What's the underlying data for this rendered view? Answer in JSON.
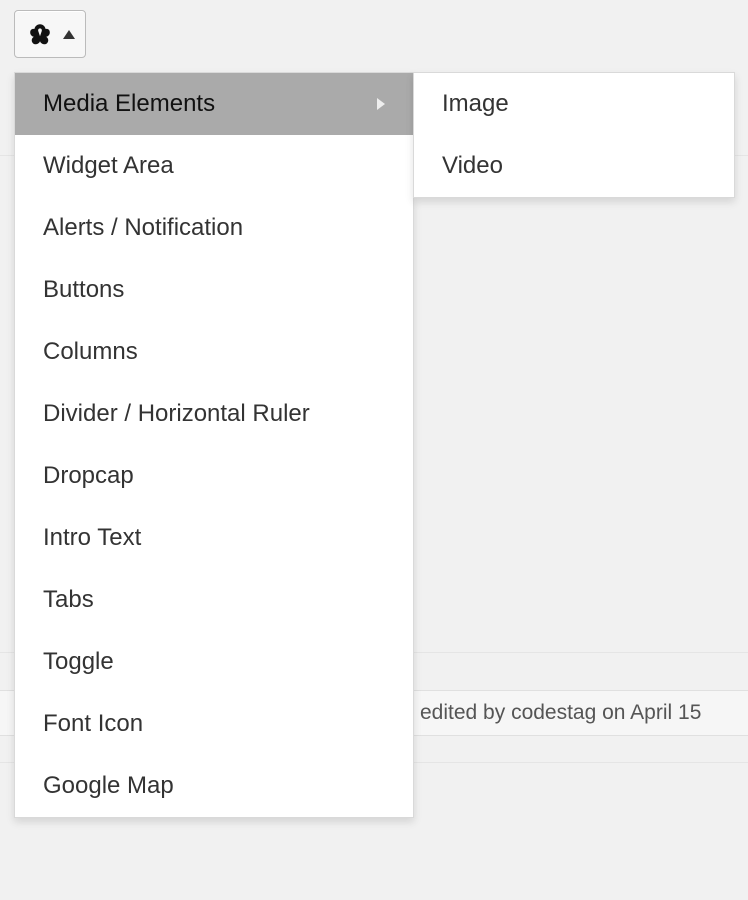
{
  "toolbar": {
    "button_icon": "antler-icon",
    "arrow_direction": "up"
  },
  "menu": {
    "items": [
      {
        "label": "Media Elements",
        "has_submenu": true,
        "active": true
      },
      {
        "label": "Widget Area",
        "has_submenu": false,
        "active": false
      },
      {
        "label": "Alerts / Notification",
        "has_submenu": false,
        "active": false
      },
      {
        "label": "Buttons",
        "has_submenu": false,
        "active": false
      },
      {
        "label": "Columns",
        "has_submenu": false,
        "active": false
      },
      {
        "label": "Divider / Horizontal Ruler",
        "has_submenu": false,
        "active": false
      },
      {
        "label": "Dropcap",
        "has_submenu": false,
        "active": false
      },
      {
        "label": "Intro Text",
        "has_submenu": false,
        "active": false
      },
      {
        "label": "Tabs",
        "has_submenu": false,
        "active": false
      },
      {
        "label": "Toggle",
        "has_submenu": false,
        "active": false
      },
      {
        "label": "Font Icon",
        "has_submenu": false,
        "active": false
      },
      {
        "label": "Google Map",
        "has_submenu": false,
        "active": false
      }
    ]
  },
  "submenu": {
    "items": [
      {
        "label": "Image"
      },
      {
        "label": "Video"
      }
    ]
  },
  "status": {
    "text": "edited by codestag on April 15"
  }
}
